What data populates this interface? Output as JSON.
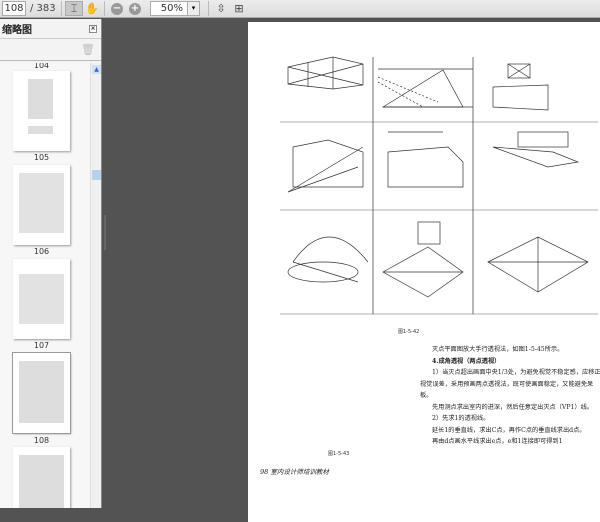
{
  "toolbar": {
    "page_current": "108",
    "page_total": "/ 383",
    "select_tool": "select-tool",
    "hand_tool": "hand-tool",
    "zoom_out": "−",
    "zoom_in": "+",
    "zoom_value": "50%",
    "zoom_dropdown": "▾"
  },
  "sidebar": {
    "title": "缩略图",
    "close": "×",
    "thumbnails": [
      {
        "label": "104"
      },
      {
        "label": "105"
      },
      {
        "label": "106"
      },
      {
        "label": "107"
      },
      {
        "label": "108"
      }
    ]
  },
  "page": {
    "fig1_caption": "图1-5-42",
    "fig2_caption": "图1-5-43",
    "paragraphs": [
      "灭点平面图放大手行透视法，如图1-5-45所示。",
      "4.成角透视（两点透视）",
      "1）当灭点超出画面中央1/3处，为避免视觉不稳定感，应移正视觉误差，采用预画两点透视法，既可使画面稳定，又能避免呆板。",
      "先用测点求出室内的进深，然后任意定出灭点（VP1）线。",
      "2）先求1的透视线。",
      "延长1的垂直线，求出C点，再作C点的垂直线求出d点。",
      "再由d点画水平线求出e点，e和1连接即可得到1"
    ],
    "footer": "98  室内设计师培训教材"
  }
}
